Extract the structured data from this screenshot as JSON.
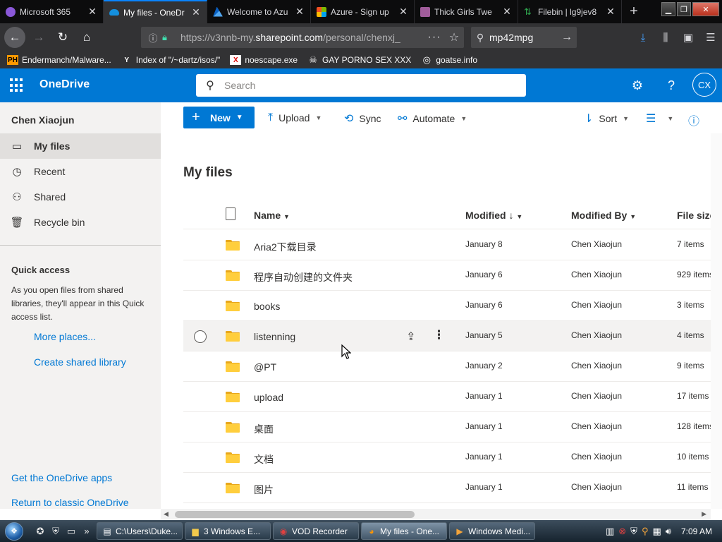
{
  "browser": {
    "tabs": [
      {
        "title": "Microsoft 365",
        "color": "#8a58d8",
        "active": false
      },
      {
        "title": "My files - OneDr",
        "color": "#1490df",
        "active": true
      },
      {
        "title": "Welcome to Azu",
        "color": "#0078d4",
        "active": false
      },
      {
        "title": "Azure - Sign up",
        "color": "#f25022",
        "active": false
      },
      {
        "title": "Thick Girls Twe",
        "color": "#a05c9a",
        "active": false
      },
      {
        "title": "Filebin | lg9jev8",
        "color": "#2fa84f",
        "active": false
      }
    ],
    "new_tab": "+",
    "url_prefix": "https://v3nnb-my.",
    "url_domain": "sharepoint.com",
    "url_rest": "/personal/chenxj_",
    "search_query": "mp42mpg",
    "bookmarks": [
      {
        "label": "Endermanch/Malware...",
        "icon": "PH"
      },
      {
        "label": "Index of \"/~dartz/isos/\"",
        "icon": "Y"
      },
      {
        "label": "noescape.exe",
        "icon": "X"
      },
      {
        "label": "GAY PORNO SEX XXX",
        "icon": "☠"
      },
      {
        "label": "goatse.info",
        "icon": "◎"
      }
    ]
  },
  "onedrive": {
    "brand": "OneDrive",
    "search_placeholder": "Search",
    "avatar_initials": "CX",
    "accent": "#0078d4"
  },
  "sidebar": {
    "user": "Chen Xiaojun",
    "items": [
      {
        "label": "My files",
        "icon": "🗀",
        "selected": true
      },
      {
        "label": "Recent",
        "icon": "◷",
        "selected": false
      },
      {
        "label": "Shared",
        "icon": "☺",
        "selected": false
      },
      {
        "label": "Recycle bin",
        "icon": "♻",
        "selected": false
      }
    ],
    "quick_access_title": "Quick access",
    "quick_access_desc": "As you open files from shared libraries, they'll appear in this Quick access list.",
    "more_places": "More places...",
    "create_shared_library": "Create shared library",
    "get_apps": "Get the OneDrive apps",
    "return_classic": "Return to classic OneDrive"
  },
  "commands": {
    "new": "New",
    "upload": "Upload",
    "sync": "Sync",
    "automate": "Automate",
    "sort": "Sort"
  },
  "page_title": "My files",
  "columns": {
    "name": "Name",
    "modified": "Modified",
    "modified_sort": "↓",
    "modified_by": "Modified By",
    "file_size": "File size"
  },
  "files": [
    {
      "name": "Aria2下载目录",
      "modified": "January 8",
      "by": "Chen Xiaojun",
      "size": "7 items"
    },
    {
      "name": "程序自动创建的文件夹",
      "modified": "January 6",
      "by": "Chen Xiaojun",
      "size": "929 items"
    },
    {
      "name": "books",
      "modified": "January 6",
      "by": "Chen Xiaojun",
      "size": "3 items"
    },
    {
      "name": "listenning",
      "modified": "January 5",
      "by": "Chen Xiaojun",
      "size": "4 items"
    },
    {
      "name": "@PT",
      "modified": "January 2",
      "by": "Chen Xiaojun",
      "size": "9 items"
    },
    {
      "name": "upload",
      "modified": "January 1",
      "by": "Chen Xiaojun",
      "size": "17 items"
    },
    {
      "name": "桌面",
      "modified": "January 1",
      "by": "Chen Xiaojun",
      "size": "128 items"
    },
    {
      "name": "文档",
      "modified": "January 1",
      "by": "Chen Xiaojun",
      "size": "10 items"
    },
    {
      "name": "图片",
      "modified": "January 1",
      "by": "Chen Xiaojun",
      "size": "11 items"
    }
  ],
  "taskbar": {
    "tasks": [
      {
        "label": "C:\\Users\\Duke...",
        "icon": "▤",
        "active": false
      },
      {
        "label": "3 Windows E...",
        "icon": "📁",
        "active": false
      },
      {
        "label": "VOD Recorder",
        "icon": "◉",
        "active": false
      },
      {
        "label": "My files - One...",
        "icon": "🦊",
        "active": true
      },
      {
        "label": "Windows Medi...",
        "icon": "▶",
        "active": false
      }
    ],
    "clock": "7:09 AM"
  }
}
